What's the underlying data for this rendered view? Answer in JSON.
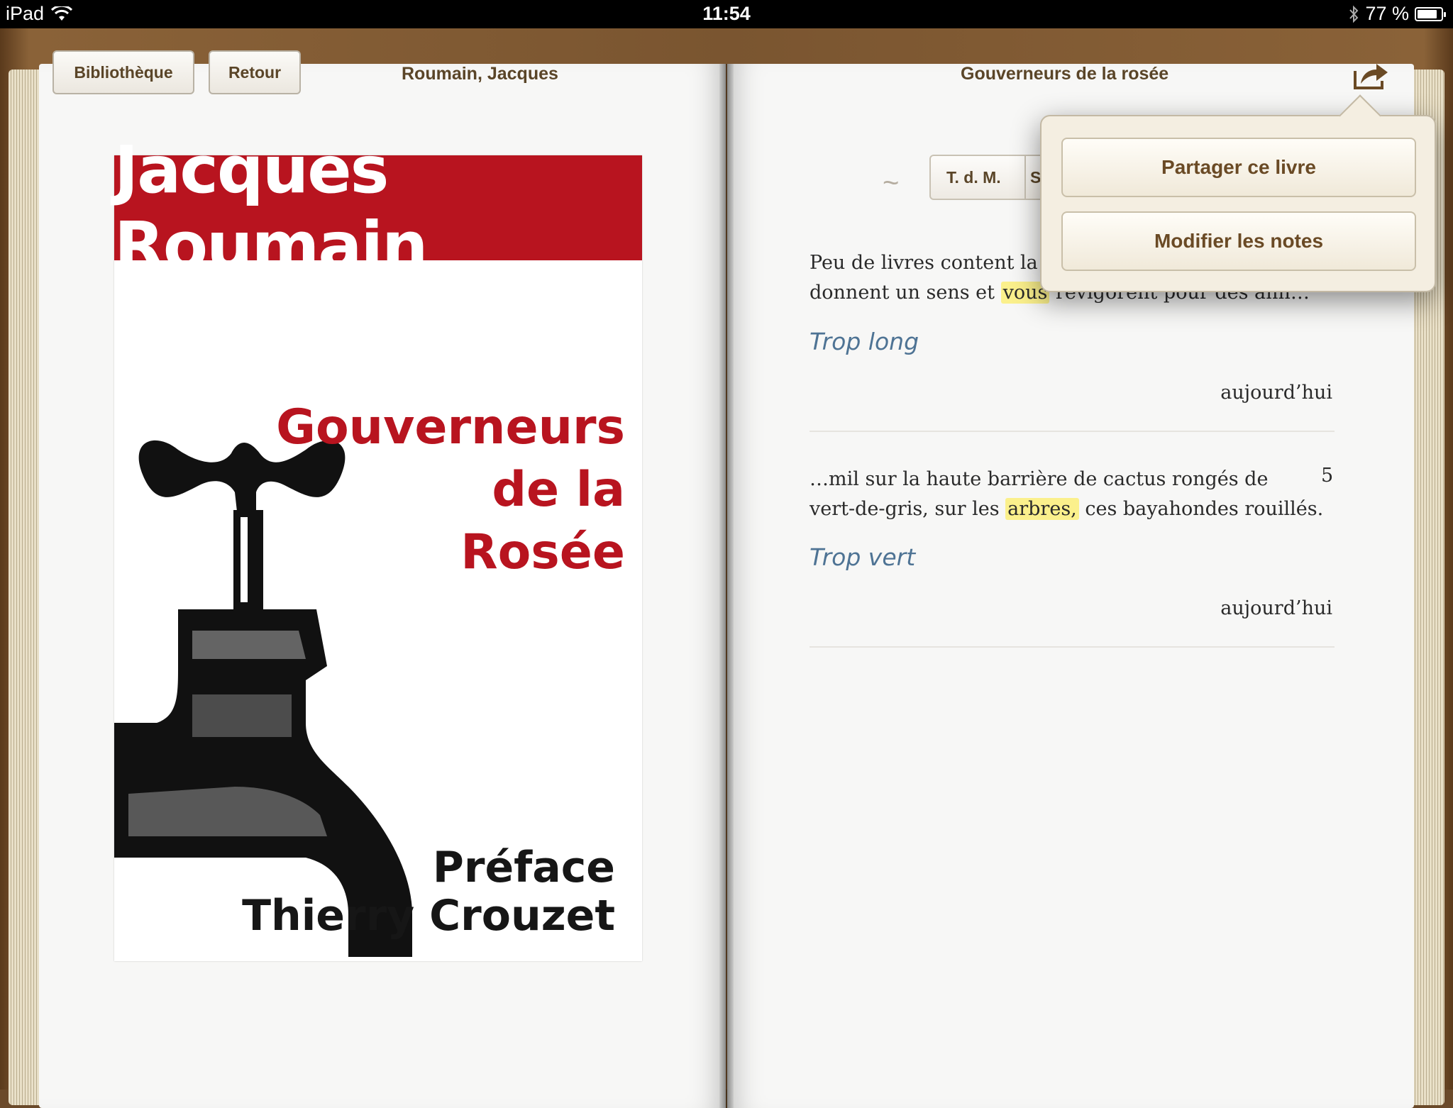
{
  "status_bar": {
    "device": "iPad",
    "time": "11:54",
    "battery": "77 %",
    "battery_level": 0.77
  },
  "left_page": {
    "library_button": "Bibliothèque",
    "back_button": "Retour",
    "author_header": "Roumain, Jacques",
    "cover": {
      "author": "Jacques Roumain",
      "title_lines": [
        "Gouverneurs",
        "de la",
        "Rosée"
      ],
      "preface_lines": [
        "Préface",
        "Thierry Crouzet"
      ]
    }
  },
  "right_page": {
    "book_title": "Gouverneurs de la rosée",
    "toc_tab": "T. d. M.",
    "toc_tab_partial": "S",
    "notes": [
      {
        "text_before": "Peu de livres content la v",
        "text_line2_before": "donnent un sens et ",
        "highlight": "vous",
        "text_after": " revigorent pour des ann…",
        "comment": "Trop long",
        "date": "aujourd’hui"
      },
      {
        "text_line1": "…mil sur la haute barrière de cactus rongés de",
        "text_line2_before": "vert-de-gris, sur les ",
        "highlight": "arbres,",
        "text_after": " ces bayahondes rouillés.",
        "page": "5",
        "comment": "Trop vert",
        "date": "aujourd’hui"
      }
    ]
  },
  "share_popover": {
    "share_book": "Partager ce livre",
    "edit_notes": "Modifier les notes"
  },
  "colors": {
    "cover_red": "#b8141f",
    "highlight": "#fbf08c",
    "comment_blue": "#4e7394",
    "button_text": "#5a4528"
  }
}
